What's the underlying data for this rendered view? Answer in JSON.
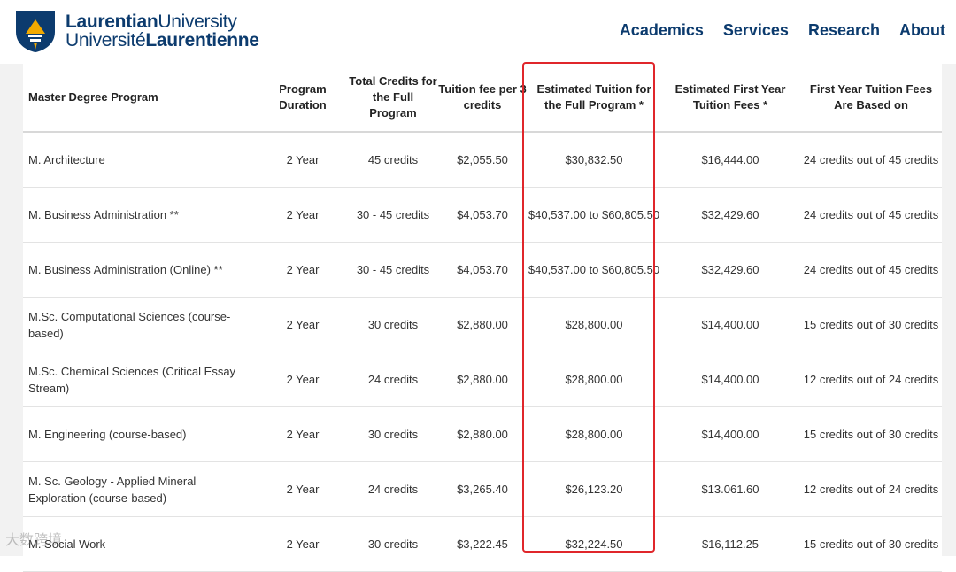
{
  "header": {
    "logo": {
      "line1_bold": "Laurentian",
      "line1_light": "University",
      "line2_light": "Université",
      "line2_bold": "Laurentienne"
    },
    "nav": [
      "Academics",
      "Services",
      "Research",
      "About"
    ]
  },
  "table": {
    "columns": [
      "Master Degree Program",
      "Program Duration",
      "Total Credits for the Full Program",
      "Tuition fee per 3 credits",
      "Estimated Tuition for the Full Program *",
      "Estimated First Year Tuition Fees *",
      "First Year Tuition Fees Are Based on"
    ],
    "rows": [
      [
        "M. Architecture",
        "2 Year",
        "45 credits",
        "$2,055.50",
        "$30,832.50",
        "$16,444.00",
        "24 credits out of 45 credits"
      ],
      [
        "M. Business Administration **",
        "2 Year",
        "30 - 45 credits",
        "$4,053.70",
        "$40,537.00 to $60,805.50",
        "$32,429.60",
        "24 credits out of 45 credits"
      ],
      [
        "M. Business Administration  (Online) **",
        "2 Year",
        "30 - 45 credits",
        "$4,053.70",
        "$40,537.00 to $60,805.50",
        "$32,429.60",
        "24 credits out of 45 credits"
      ],
      [
        "M.Sc. Computational Sciences (course-based)",
        "2 Year",
        "30 credits",
        "$2,880.00",
        "$28,800.00",
        "$14,400.00",
        "15 credits out of 30 credits"
      ],
      [
        "M.Sc. Chemical Sciences (Critical Essay Stream)",
        "2 Year",
        "24 credits",
        "$2,880.00",
        "$28,800.00",
        "$14,400.00",
        "12 credits out of 24 credits"
      ],
      [
        "M. Engineering (course-based)",
        "2 Year",
        "30 credits",
        "$2,880.00",
        "$28,800.00",
        "$14,400.00",
        "15 credits out of 30 credits"
      ],
      [
        "M. Sc. Geology - Applied Mineral Exploration (course-based)",
        "2 Year",
        "24 credits",
        "$3,265.40",
        "$26,123.20",
        "$13.061.60",
        "12 credits out of 24 credits"
      ],
      [
        "M. Social Work",
        "2 Year",
        "30 credits",
        "$3,222.45",
        "$32,224.50",
        "$16,112.25",
        "15 credits out of 30 credits"
      ]
    ]
  },
  "watermark": "大数跨境",
  "colors": {
    "brand": "#0c3b6e",
    "highlight": "#e0262b",
    "gold": "#f2a900"
  }
}
